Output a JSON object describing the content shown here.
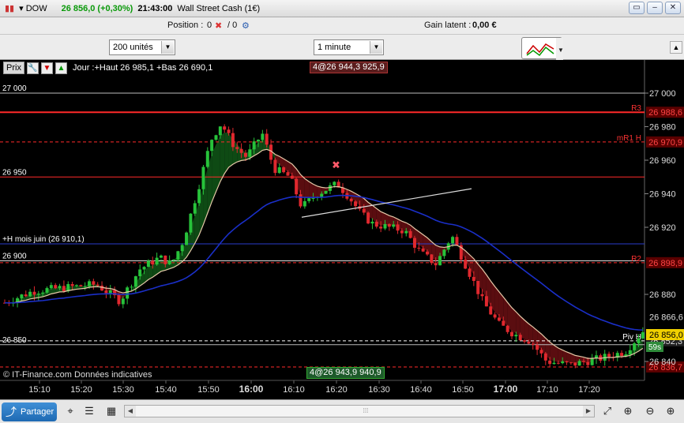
{
  "titlebar": {
    "instrument": "DOW",
    "price": "26 856,0",
    "change": "(+0,30%)",
    "time": "21:43:00",
    "name": "Wall Street Cash (1€)",
    "window_buttons": [
      "▭",
      "–",
      "✕"
    ]
  },
  "positionbar": {
    "position_label": "Position :",
    "position_value": "0",
    "position_value2": "/ 0",
    "gain_label": "Gain latent :",
    "gain_value": "0,00 €"
  },
  "controls": {
    "units_select": "200 unités",
    "timeframe_select": "1 minute"
  },
  "infobar": {
    "prix_label": "Prix",
    "day_text": "Jour :+Haut 26 985,1 +Bas 26 690,1"
  },
  "order_tags": {
    "sell": "4@26 944,3 925,9",
    "buy": "4@26 943,9 940,9"
  },
  "chart_data": {
    "type": "candlestick",
    "y_axis": {
      "ticks": [
        "27 000",
        "26 980",
        "26 960",
        "26 940",
        "26 920",
        "26 880",
        "26 840"
      ],
      "range": [
        26828,
        27003
      ]
    },
    "x_axis": {
      "ticks": [
        "15:10",
        "15:20",
        "15:30",
        "15:40",
        "15:50",
        "16:00",
        "16:10",
        "16:20",
        "16:30",
        "16:40",
        "16:50",
        "17:00",
        "17:10",
        "17:20"
      ],
      "bold_ticks": [
        "16:00",
        "17:00"
      ]
    },
    "level_lines": [
      {
        "label": "R3",
        "value": "26 988,6",
        "price": 26988.6,
        "color": "#ff2a2a",
        "style": "solid"
      },
      {
        "label": "mR1 H",
        "value": "26 970,9",
        "price": 26970.9,
        "color": "#ff2a2a",
        "style": "dashed"
      },
      {
        "label": "R2",
        "value": "26 898,9",
        "price": 26898.9,
        "color": "#ff2a2a",
        "style": "dashed"
      },
      {
        "label": "Piv H",
        "value": "26 852,3",
        "price": 26852.3,
        "color": "#ffffff",
        "style": "dashed"
      },
      {
        "label": "",
        "value": "26 836,7",
        "price": 26836.7,
        "color": "#ff2a2a",
        "style": "dashed"
      }
    ],
    "left_labels": [
      {
        "text": "27 000",
        "price": 27000
      },
      {
        "text": "26 950",
        "price": 26950
      },
      {
        "text": "+H mois juin (26 910,1)",
        "price": 26910.1
      },
      {
        "text": "26 900",
        "price": 26900
      },
      {
        "text": "26 850",
        "price": 26850
      }
    ],
    "current_price": {
      "value": "26 856,0",
      "price": 26856.0,
      "timer": "59s"
    },
    "prev_close": {
      "value": "26 866,6",
      "price": 26866.6
    },
    "copyright": "© IT-Finance.com Données indicatives"
  },
  "footer": {
    "share_label": "Partager"
  }
}
